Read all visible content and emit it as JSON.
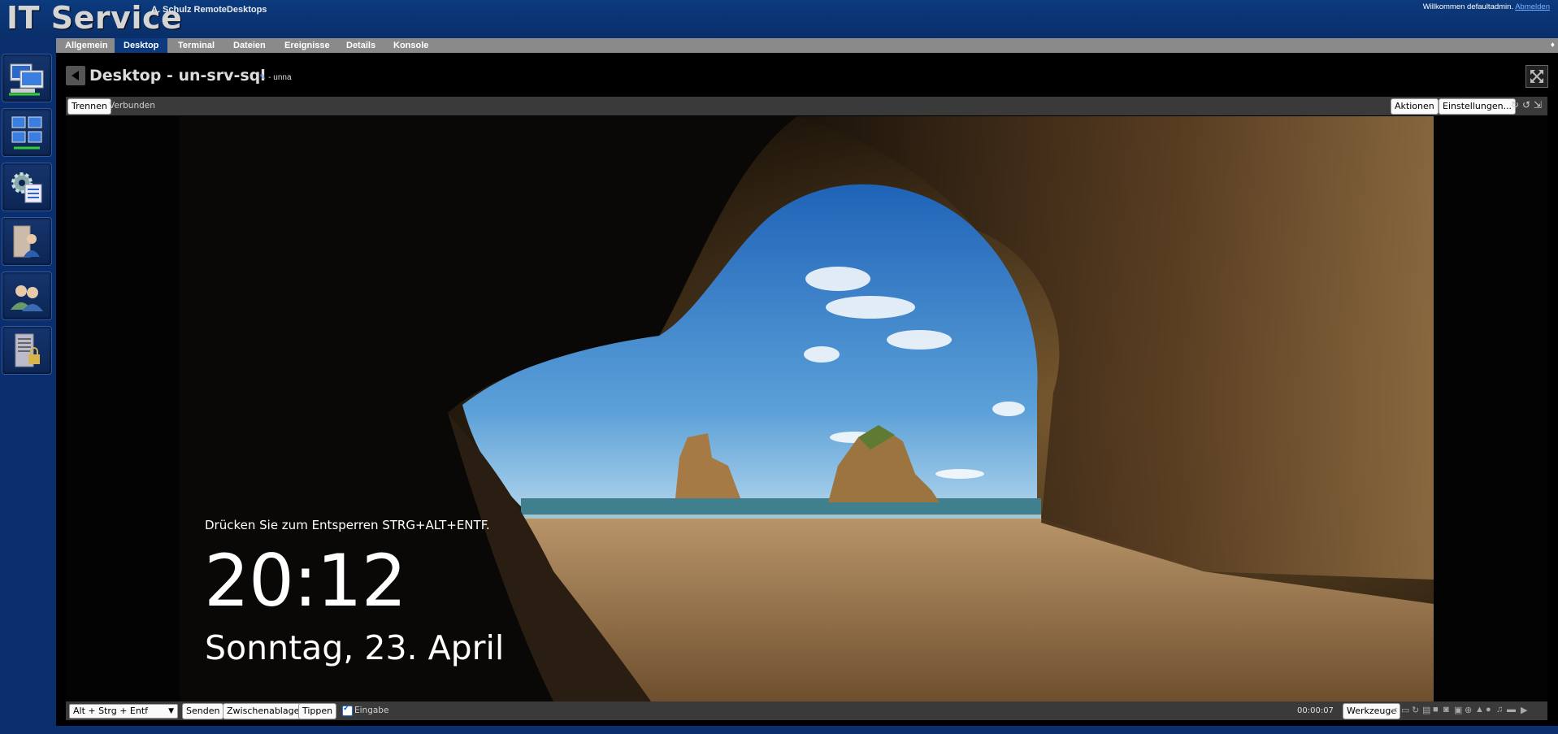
{
  "header": {
    "brand": "IT Service",
    "subtitle": "A. Schulz RemoteDesktops",
    "welcome_text": "Willkommen defaultadmin.",
    "logout_label": "Abmelden"
  },
  "nav": {
    "items": [
      {
        "name": "desktop-computers-icon"
      },
      {
        "name": "multi-desktop-icon"
      },
      {
        "name": "settings-checklist-icon"
      },
      {
        "name": "user-door-icon"
      },
      {
        "name": "users-icon"
      },
      {
        "name": "server-lock-icon"
      }
    ]
  },
  "tabs": [
    {
      "label": "Allgemein",
      "active": false
    },
    {
      "label": "Desktop",
      "active": true
    },
    {
      "label": "Terminal",
      "active": false
    },
    {
      "label": "Dateien",
      "active": false
    },
    {
      "label": "Ereignisse",
      "active": false
    },
    {
      "label": "Details",
      "active": false
    },
    {
      "label": "Konsole",
      "active": false
    }
  ],
  "page": {
    "title": "Desktop - un-srv-sql",
    "subtitle": "- unna"
  },
  "toolbar": {
    "disconnect_label": "Trennen",
    "status": "Verbunden",
    "actions_label": "Aktionen",
    "settings_label": "Einstellungen..."
  },
  "remote_screen": {
    "lock_message": "Drücken Sie zum Entsperren STRG+ALT+ENTF.",
    "time": "20:12",
    "date": "Sonntag, 23. April"
  },
  "bottombar": {
    "key_combo_selected": "Alt + Strg + Entf",
    "send_label": "Senden",
    "clipboard_label": "Zwischenablage",
    "type_label": "Tippen",
    "input_label": "Eingabe",
    "input_checked": true,
    "timer": "00:00:07",
    "tools_label": "Werkzeuge"
  },
  "colors": {
    "header_bg": "#0b3a7e",
    "tabbar_bg": "#8a8a8a",
    "active_tab": "#0b3a7e",
    "toolbar_bg": "#3a3a3a"
  }
}
